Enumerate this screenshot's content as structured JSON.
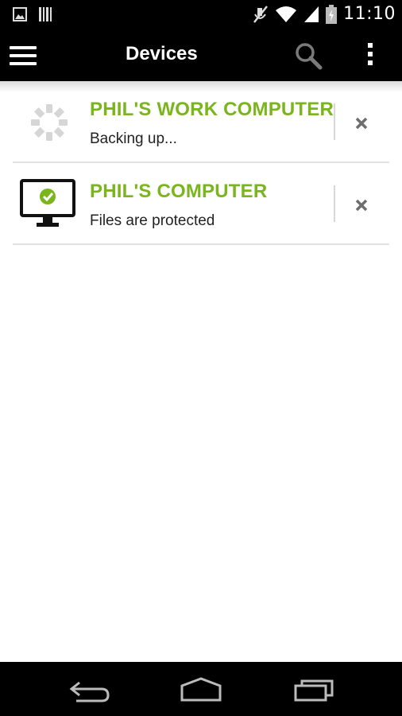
{
  "status_bar": {
    "time": "11:10",
    "icons": [
      "image-icon",
      "barcode-icon",
      "mute-icon",
      "wifi-icon",
      "signal-icon",
      "battery-charging-icon"
    ]
  },
  "action_bar": {
    "title": "Devices",
    "icons": [
      "menu-icon",
      "search-icon",
      "overflow-menu-icon"
    ]
  },
  "devices": [
    {
      "name": "PHIL'S WORK COMPUTER",
      "status": "Backing up...",
      "icon": "loading-spinner-icon"
    },
    {
      "name": "PHIL'S COMPUTER",
      "status": "Files are protected",
      "icon": "monitor-protected-icon"
    }
  ],
  "colors": {
    "accent": "#7ab51d",
    "bar_background": "#000000",
    "divider": "#e2e2e2",
    "spinner": "#d6d6d6"
  },
  "nav_bar": {
    "icons": [
      "back-icon",
      "home-icon",
      "recent-apps-icon"
    ]
  }
}
